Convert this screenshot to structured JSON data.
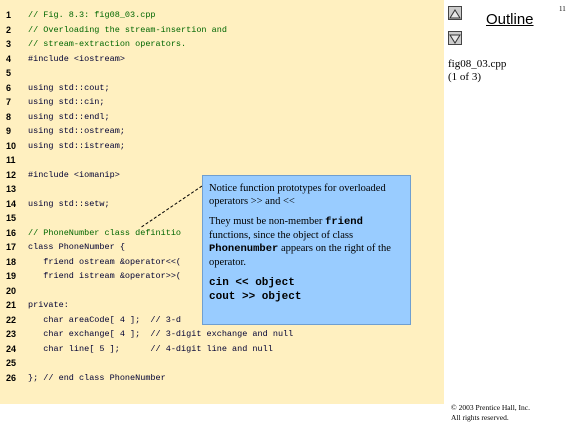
{
  "page_number": "11",
  "outline": {
    "title": "Outline",
    "up_icon": "triangle-up-icon",
    "down_icon": "triangle-down-icon",
    "file": "fig08_03.cpp",
    "page": "(1 of 3)"
  },
  "code_lines": [
    {
      "n": "1",
      "text": "// Fig. 8.3: fig08_03.cpp",
      "comment": true
    },
    {
      "n": "2",
      "text": "// Overloading the stream-insertion and",
      "comment": true
    },
    {
      "n": "3",
      "text": "// stream-extraction operators.",
      "comment": true
    },
    {
      "n": "4",
      "text": "#include <iostream>",
      "comment": false
    },
    {
      "n": "5",
      "text": "",
      "comment": false
    },
    {
      "n": "6",
      "text": "using std::cout;",
      "comment": false
    },
    {
      "n": "7",
      "text": "using std::cin;",
      "comment": false
    },
    {
      "n": "8",
      "text": "using std::endl;",
      "comment": false
    },
    {
      "n": "9",
      "text": "using std::ostream;",
      "comment": false
    },
    {
      "n": "10",
      "text": "using std::istream;",
      "comment": false
    },
    {
      "n": "11",
      "text": "",
      "comment": false
    },
    {
      "n": "12",
      "text": "#include <iomanip>",
      "comment": false
    },
    {
      "n": "13",
      "text": "",
      "comment": false
    },
    {
      "n": "14",
      "text": "using std::setw;",
      "comment": false
    },
    {
      "n": "15",
      "text": "",
      "comment": false
    },
    {
      "n": "16",
      "text": "// PhoneNumber class definitio",
      "comment": true
    },
    {
      "n": "17",
      "text": "class PhoneNumber {",
      "comment": false
    },
    {
      "n": "18",
      "text": "   friend ostream &operator<<(",
      "comment": false
    },
    {
      "n": "19",
      "text": "   friend istream &operator>>(",
      "comment": false
    },
    {
      "n": "20",
      "text": "",
      "comment": false
    },
    {
      "n": "21",
      "text": "private:",
      "comment": false
    },
    {
      "n": "22",
      "text": "   char areaCode[ 4 ];  // 3-d",
      "comment": false
    },
    {
      "n": "23",
      "text": "   char exchange[ 4 ];  // 3-digit exchange and null",
      "comment": false
    },
    {
      "n": "24",
      "text": "   char line[ 5 ];      // 4-digit line and null",
      "comment": false
    },
    {
      "n": "25",
      "text": "",
      "comment": false
    },
    {
      "n": "26",
      "text": "}; // end class PhoneNumber",
      "comment": false
    }
  ],
  "callout": {
    "line1": "Notice function prototypes for overloaded operators >> and <<",
    "line2_pre": "They must be non-member ",
    "line2_mono": "friend",
    "line2_mid": " functions, since the object of class ",
    "line2_mono2": "Phonenumber",
    "line2_post": " appears on the right of the operator.",
    "code1": "cin << object",
    "code2": "cout >> object"
  },
  "copyright": {
    "line1": "© 2003 Prentice Hall, Inc.",
    "line2": "All rights reserved."
  }
}
